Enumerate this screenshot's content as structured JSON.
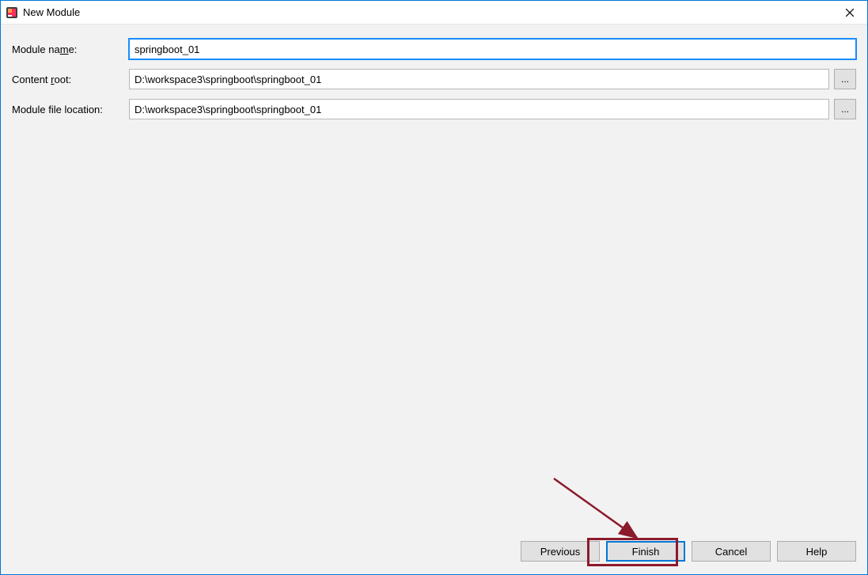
{
  "titlebar": {
    "title": "New Module"
  },
  "form": {
    "module_name": {
      "label_pre": "Module na",
      "label_mnemonic": "m",
      "label_post": "e:",
      "value": "springboot_01"
    },
    "content_root": {
      "label_pre": "Content ",
      "label_mnemonic": "r",
      "label_post": "oot:",
      "value": "D:\\workspace3\\springboot\\springboot_01",
      "browse": "..."
    },
    "module_file_location": {
      "label_pre": "Module file location:",
      "value": "D:\\workspace3\\springboot\\springboot_01",
      "browse": "..."
    }
  },
  "buttons": {
    "previous": "Previous",
    "finish": "Finish",
    "cancel": "Cancel",
    "help": "Help"
  }
}
